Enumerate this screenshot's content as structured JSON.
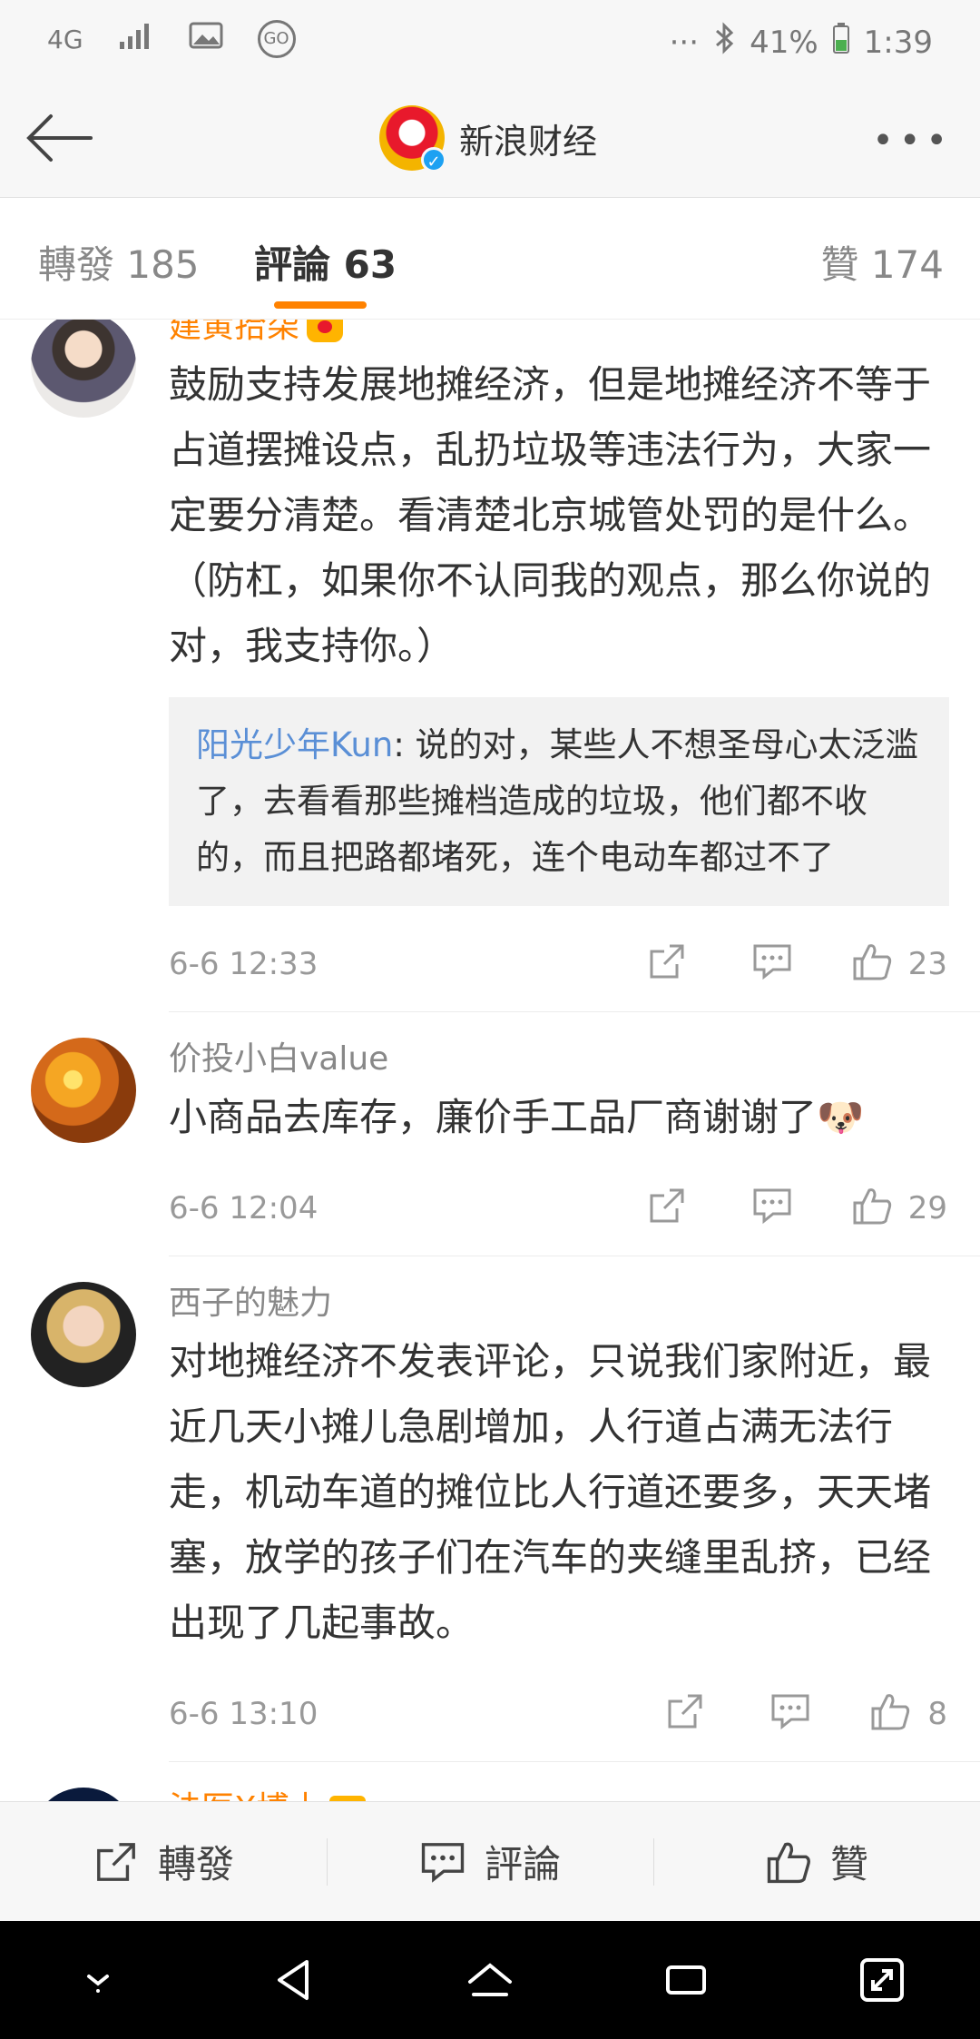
{
  "status_bar": {
    "network": "4G",
    "mode": "GO",
    "overflow": "···",
    "battery": "41%",
    "time": "1:39"
  },
  "nav": {
    "title": "新浪财经",
    "more": "•••"
  },
  "tabs": [
    {
      "label": "轉發 185"
    },
    {
      "label": "評論 63"
    },
    {
      "label": "贊 174"
    }
  ],
  "comments": [
    {
      "user": "建黄拾柒",
      "vip": true,
      "text": "鼓励支持发展地摊经济，但是地摊经济不等于占道摆摊设点，乱扔垃圾等违法行为，大家一定要分清楚。看清楚北京城管处罚的是什么。（防杠，如果你不认同我的观点，那么你说的对，我支持你。）",
      "reply_user": "阳光少年Kun",
      "reply_text": ": 说的对，某些人不想圣母心太泛滥了，去看看那些摊档造成的垃圾，他们都不收的，而且把路都堵死，连个电动车都过不了",
      "time": "6-6 12:33",
      "likes": "23"
    },
    {
      "user": "价投小白value",
      "vip": false,
      "text": "小商品去库存，廉价手工品厂商谢谢了🐶",
      "time": "6-6 12:04",
      "likes": "29"
    },
    {
      "user": "西子的魅力",
      "vip": false,
      "text": "对地摊经济不发表评论，只说我们家附近，最近几天小摊儿急剧增加，人行道占满无法行走，机动车道的摊位比人行道还要多，天天堵塞，放学的孩子们在汽车的夹缝里乱挤，已经出现了几起事故。",
      "time": "6-6 13:10",
      "likes": "8"
    },
    {
      "user": "法医X博士",
      "vip": true
    }
  ],
  "bottom_bar": {
    "repost": "轉發",
    "comment": "評論",
    "like": "贊"
  },
  "colors": {
    "accent": "#ff8200",
    "link": "#5a8fd6",
    "bar": "#f7f7f7"
  }
}
